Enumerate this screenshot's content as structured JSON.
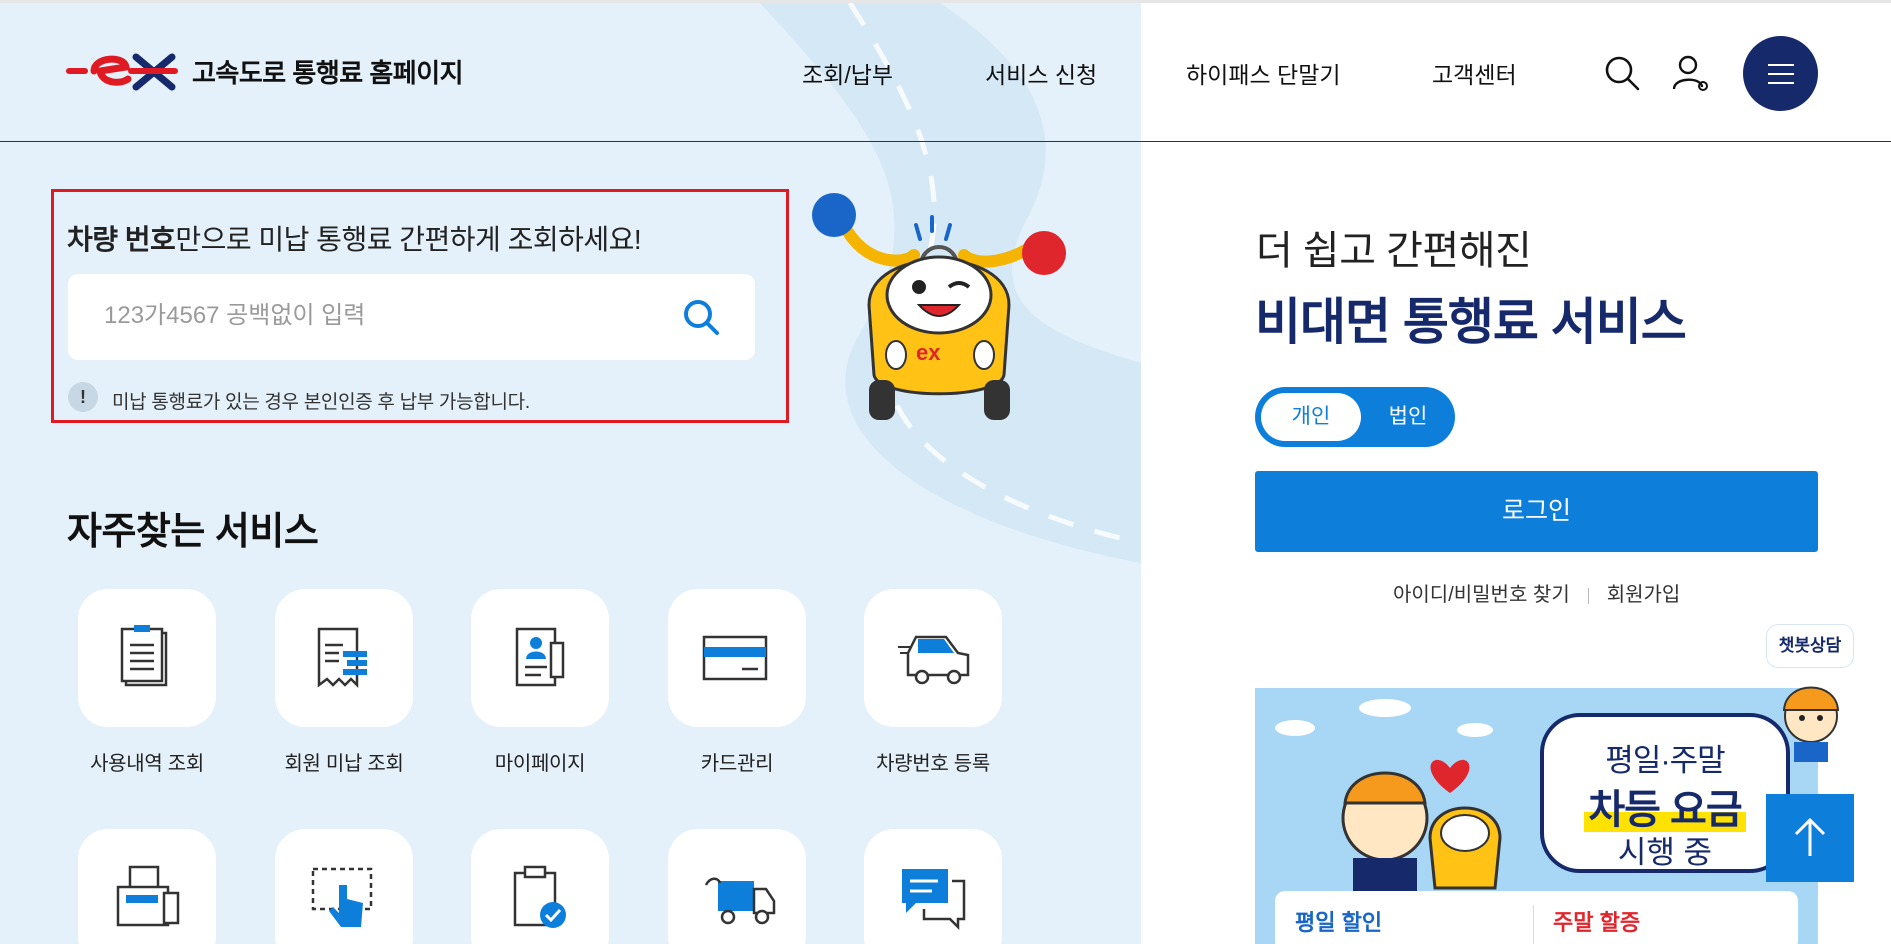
{
  "header": {
    "site_title": "고속도로 통행료 홈페이지",
    "logo_icon": "ex-logo",
    "nav": [
      "조회/납부",
      "서비스 신청",
      "하이패스 단말기",
      "고객센터"
    ],
    "icons": [
      "search-icon",
      "user-icon",
      "menu-icon"
    ]
  },
  "search": {
    "title_bold": "차량 번호",
    "title_rest": "만으로 미납 통행료 간편하게 조회하세요!",
    "placeholder": "123가4567 공백없이 입력",
    "value": "",
    "notice_mark": "!",
    "notice": "미납 통행료가 있는 경우 본인인증 후 납부 가능합니다."
  },
  "frequent": {
    "title": "자주찾는 서비스",
    "items": [
      {
        "label": "사용내역 조회",
        "icon": "document-list-icon"
      },
      {
        "label": "회원 미납 조회",
        "icon": "receipt-icon"
      },
      {
        "label": "마이페이지",
        "icon": "profile-card-icon"
      },
      {
        "label": "카드관리",
        "icon": "credit-card-icon"
      },
      {
        "label": "차량번호 등록",
        "icon": "vehicle-icon"
      },
      {
        "label": "",
        "icon": "fax-icon"
      },
      {
        "label": "",
        "icon": "touch-screen-icon"
      },
      {
        "label": "",
        "icon": "clipboard-check-icon"
      },
      {
        "label": "",
        "icon": "truck-icon"
      },
      {
        "label": "",
        "icon": "chat-icon"
      }
    ]
  },
  "login": {
    "subtitle": "더 쉽고 간편해진",
    "title": "비대면 통행료 서비스",
    "toggle_personal": "개인",
    "toggle_corporate": "법인",
    "selected": "개인",
    "login_button": "로그인",
    "find_link": "아이디/비밀번호 찾기",
    "signup_link": "회원가입"
  },
  "chatbot": {
    "label": "챗봇상담"
  },
  "banner": {
    "line1": "평일·주말",
    "line2": "차등 요금",
    "line3": "시행 중",
    "card_left": "평일 할인",
    "card_right": "주말 할증"
  },
  "colors": {
    "brand_navy": "#15296b",
    "accent_blue": "#0d7fdb",
    "highlight_red": "#e01a22",
    "left_background": "#e4f1fa"
  }
}
